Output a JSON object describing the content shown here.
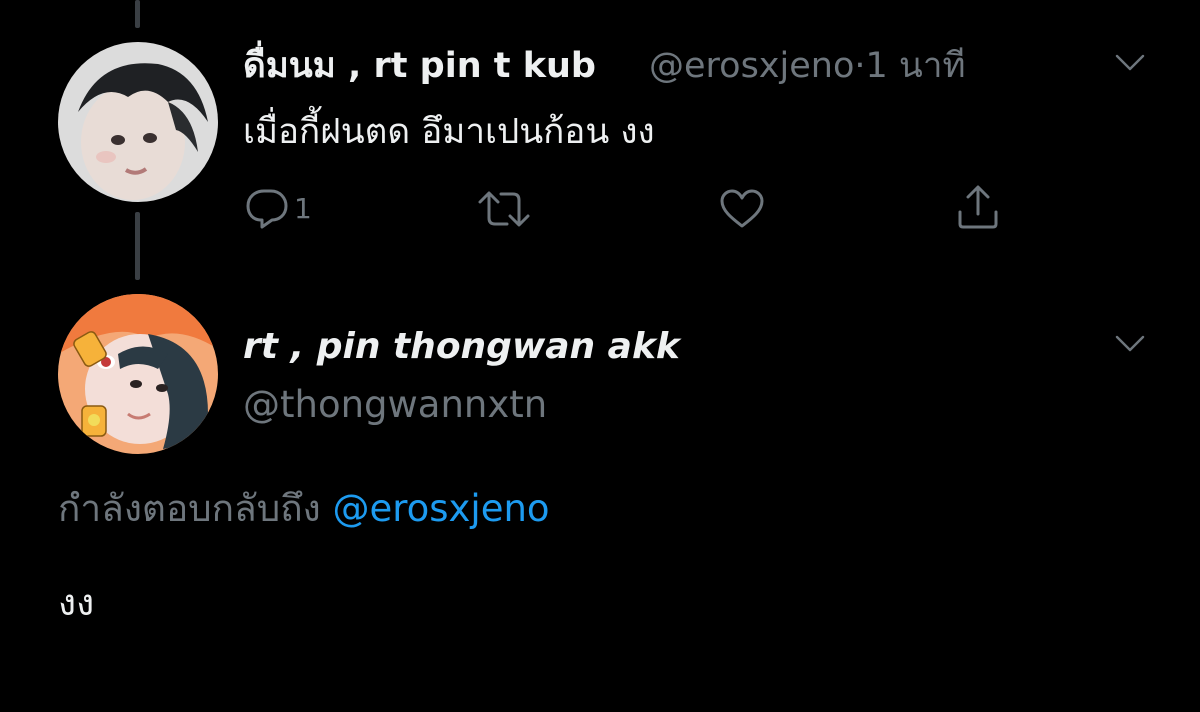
{
  "tweet": {
    "display_name": "ดื่มนม , rt pin t kub",
    "handle": "@erosxjeno",
    "separator": "·",
    "time": "1 นาที",
    "text": "เมื่อกี้ฝนตด อึมาเปนก้อน งง",
    "actions": {
      "reply_count": "1",
      "retweet_count": "",
      "like_count": ""
    }
  },
  "reply": {
    "display_name": "rt , pin thongwan akk",
    "handle": "@thongwannxtn",
    "replying_to_label": "กำลังตอบกลับถึง",
    "replying_to_handle": "@erosxjeno",
    "text": "งง"
  },
  "colors": {
    "background": "#000000",
    "text": "#e7e9ea",
    "muted": "#6e767d",
    "link": "#1d9bf0"
  },
  "icons": [
    "chevron-down-icon",
    "reply-icon",
    "retweet-icon",
    "like-icon",
    "share-icon"
  ]
}
